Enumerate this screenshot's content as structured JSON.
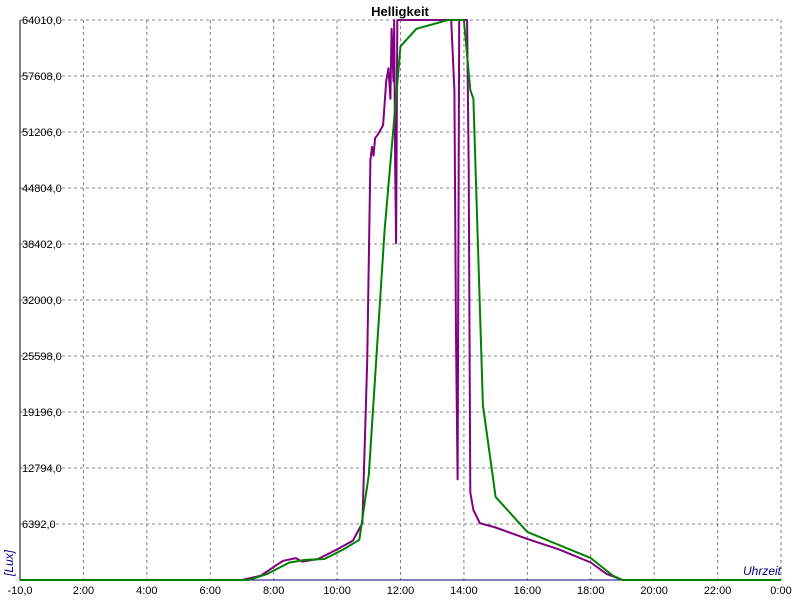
{
  "chart_data": {
    "type": "line",
    "title": "Helligkeit",
    "xlabel": "Uhrzeit",
    "ylabel": "[Lux]",
    "x_tick_labels": [
      "-10,0",
      "2:00",
      "4:00",
      "6:00",
      "8:00",
      "10:00",
      "12:00",
      "14:00",
      "16:00",
      "18:00",
      "20:00",
      "22:00",
      "0:00"
    ],
    "y_tick_labels": [
      "6392,0",
      "12794,0",
      "19196,0",
      "25598,0",
      "32000,0",
      "38402,0",
      "44804,0",
      "51206,0",
      "57608,0",
      "64010,0"
    ],
    "xlim": [
      0,
      24
    ],
    "ylim": [
      0,
      64010
    ],
    "grid": true,
    "colors": {
      "purple": "#800080",
      "green": "#008000",
      "axis_label": "#000080",
      "grid": "#808080"
    },
    "series": [
      {
        "color": "#800080",
        "x": [
          0,
          7.0,
          7.6,
          8.0,
          8.3,
          8.7,
          8.9,
          9.4,
          10.0,
          10.5,
          10.8,
          10.95,
          11.05,
          11.1,
          11.15,
          11.2,
          11.3,
          11.45,
          11.55,
          11.62,
          11.68,
          11.72,
          11.78,
          11.8,
          11.83,
          11.86,
          11.9,
          11.95,
          12.0,
          12.3,
          13.6,
          13.7,
          13.75,
          13.8,
          13.85,
          13.9,
          14.0,
          14.1,
          14.15,
          14.2,
          14.3,
          14.5,
          15.0,
          16.0,
          17.0,
          18.0,
          18.5,
          19.0,
          24
        ],
        "y": [
          0,
          0,
          500,
          1500,
          2200,
          2500,
          2100,
          2400,
          3500,
          4500,
          6500,
          25000,
          48000,
          49500,
          48500,
          50500,
          51000,
          52000,
          57000,
          58500,
          55000,
          63000,
          57000,
          64000,
          48000,
          38500,
          64000,
          64010,
          64010,
          64010,
          64010,
          56000,
          28000,
          11500,
          64010,
          64010,
          64010,
          64010,
          47000,
          10000,
          8000,
          6500,
          6000,
          4700,
          3500,
          2000,
          700,
          0,
          0
        ]
      },
      {
        "color": "#008000",
        "x": [
          0,
          7.2,
          7.8,
          8.5,
          9.0,
          9.6,
          10.2,
          10.7,
          11.0,
          11.5,
          12.0,
          12.5,
          13.5,
          14.0,
          14.2,
          14.3,
          14.6,
          15.0,
          16.0,
          17.0,
          18.0,
          18.7,
          19.0,
          24
        ],
        "y": [
          0,
          0,
          700,
          2000,
          2300,
          2400,
          3500,
          4600,
          12000,
          40000,
          61000,
          63000,
          64010,
          64010,
          56000,
          55000,
          20000,
          9500,
          5500,
          4000,
          2500,
          500,
          0,
          0
        ]
      }
    ]
  }
}
